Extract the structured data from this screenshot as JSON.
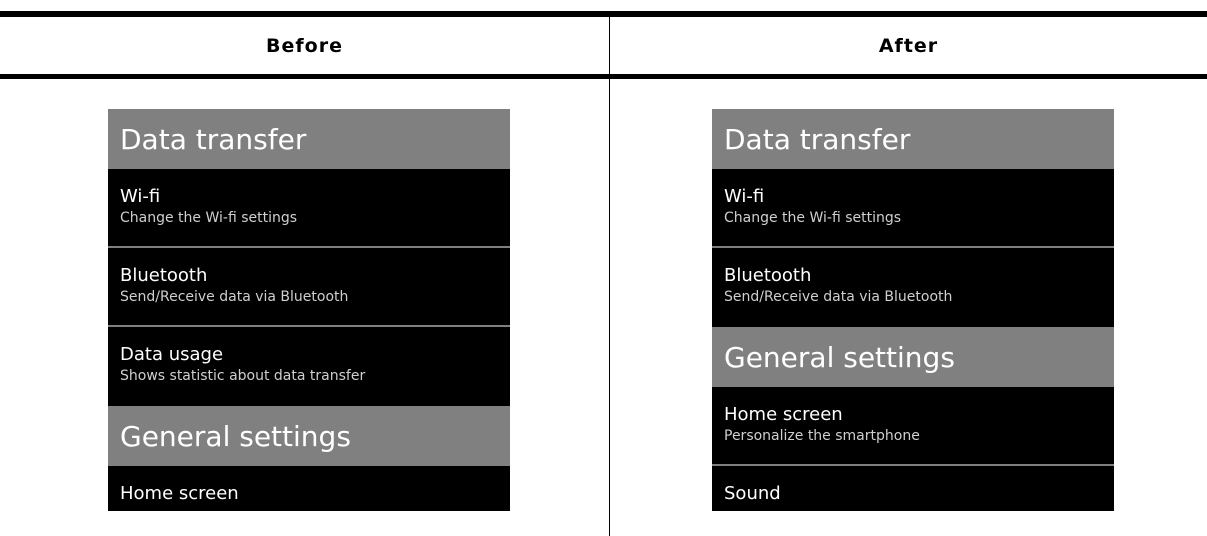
{
  "columns": {
    "before": "Before",
    "after": "After"
  },
  "before_screen": {
    "header1": "Data transfer",
    "items": [
      {
        "title": "Wi-fi",
        "subtitle": "Change the Wi-fi settings"
      },
      {
        "title": "Bluetooth",
        "subtitle": "Send/Receive data via Bluetooth"
      },
      {
        "title": "Data usage",
        "subtitle": "Shows statistic about data transfer"
      }
    ],
    "header2": "General settings",
    "items2": [
      {
        "title": "Home screen"
      }
    ]
  },
  "after_screen": {
    "header1": "Data transfer",
    "items": [
      {
        "title": "Wi-fi",
        "subtitle": "Change the Wi-fi settings"
      },
      {
        "title": "Bluetooth",
        "subtitle": "Send/Receive data via Bluetooth"
      }
    ],
    "header2": "General settings",
    "items2": [
      {
        "title": "Home screen",
        "subtitle": "Personalize the smartphone"
      },
      {
        "title": "Sound"
      }
    ]
  },
  "colors": {
    "section_header_bg": "#808080",
    "screen_bg": "#000000",
    "text_primary": "#ffffff",
    "text_secondary": "#cfcfcf",
    "separator": "#7f7f7f"
  }
}
